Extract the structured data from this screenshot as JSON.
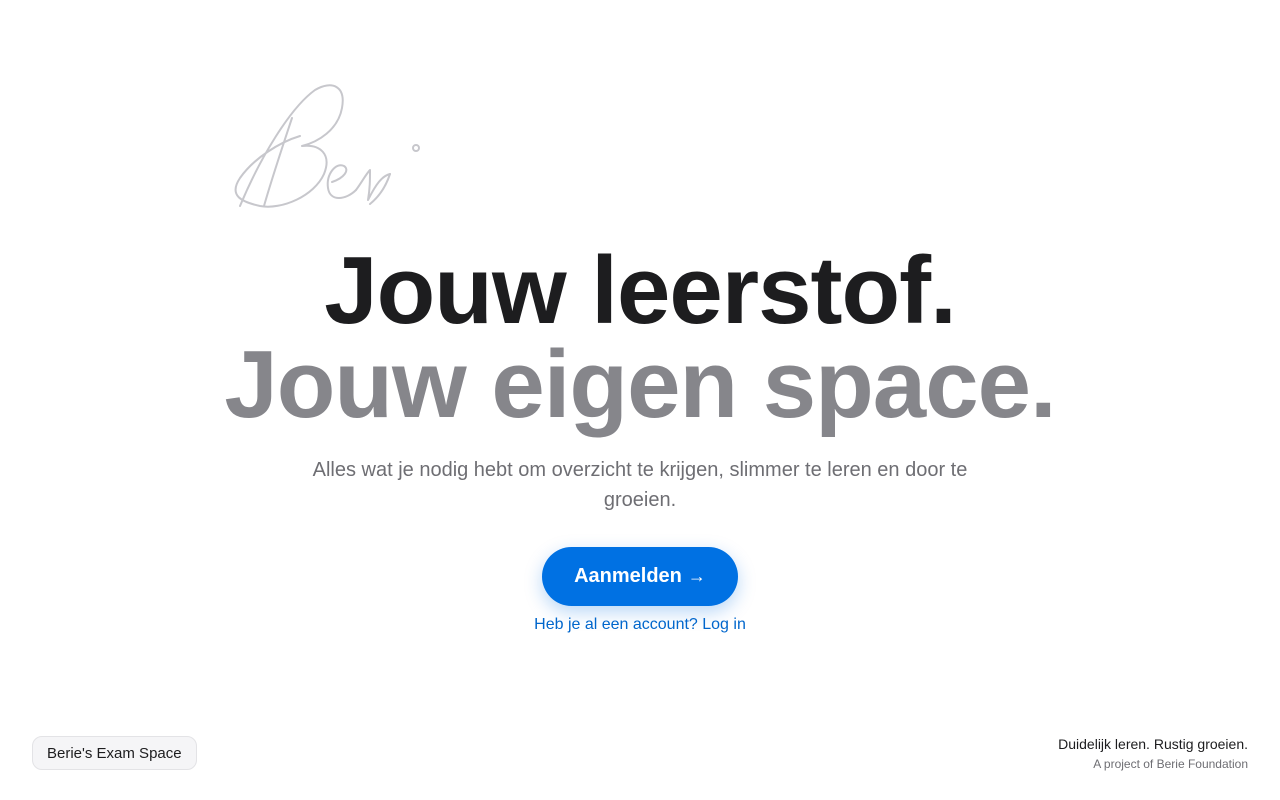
{
  "logo": {
    "signature_text": "Beri",
    "stroke_color": "#c7c7cc"
  },
  "hero": {
    "headline_line1": "Jouw leerstof.",
    "headline_line2": "Jouw eigen space.",
    "subtitle": "Alles wat je nodig hebt om overzicht te krijgen, slimmer te leren en door te groeien."
  },
  "actions": {
    "signup_label": "Aanmelden",
    "signup_arrow": "→",
    "login_link": "Heb je al een account? Log in"
  },
  "footer": {
    "badge_label": "Berie's Exam Space",
    "tagline": "Duidelijk leren. Rustig groeien.",
    "project_credit": "A project of Berie Foundation"
  },
  "colors": {
    "primary": "#0071e3",
    "link": "#0066cc",
    "headline_dark": "#1d1d1f",
    "headline_muted": "#86868b"
  }
}
